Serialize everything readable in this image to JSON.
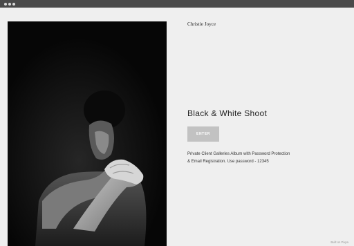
{
  "window": {
    "controls": [
      "dot-icon",
      "dot-icon",
      "dot-icon"
    ]
  },
  "header": {
    "brand": "Christie Joyce"
  },
  "gallery": {
    "title": "Black & White Shoot",
    "enter_label": "ENTER",
    "description_line1": "Private Client Galleries Album with Password Protection",
    "description_line2": "& Email Registration. Use password - 12345"
  },
  "footer": {
    "built_on": "Built on Pixpa"
  },
  "colors": {
    "background": "#efefef",
    "button": "#c2c2c2",
    "photo_background": "#070707"
  }
}
